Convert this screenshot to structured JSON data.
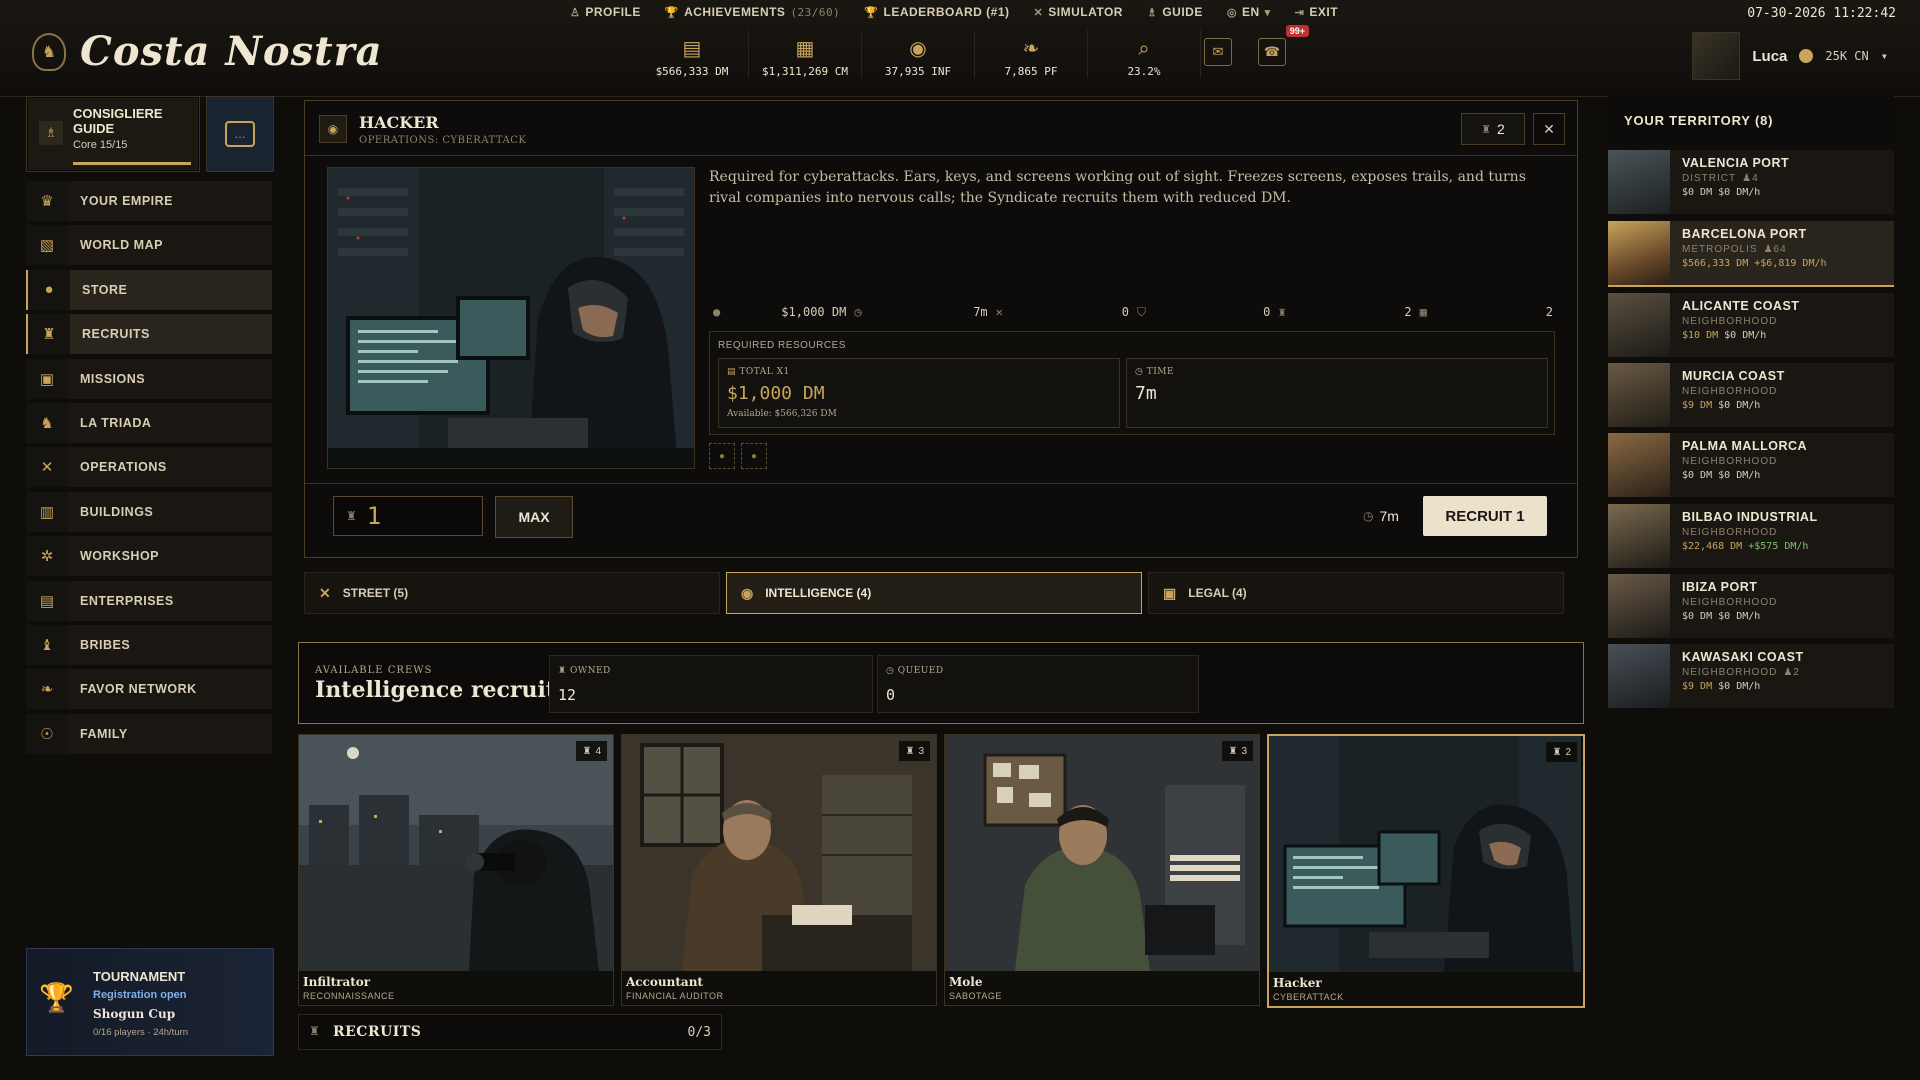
{
  "app": {
    "title": "Costa Nostra",
    "datetime": "07-30-2026 11:22:42"
  },
  "topnav": [
    {
      "label": "PROFILE",
      "sub": "",
      "icon": "user-icon"
    },
    {
      "label": "ACHIEVEMENTS",
      "sub": "(23/60)",
      "icon": "trophy-icon"
    },
    {
      "label": "LEADERBOARD (#1)",
      "sub": "",
      "icon": "trophy-icon"
    },
    {
      "label": "SIMULATOR",
      "sub": "",
      "icon": "crossed-swords-icon"
    },
    {
      "label": "GUIDE",
      "sub": "",
      "icon": "person-icon"
    },
    {
      "label": "EN",
      "sub": "",
      "icon": "globe-icon"
    },
    {
      "label": "EXIT",
      "sub": "",
      "icon": "exit-icon"
    }
  ],
  "resources": [
    {
      "value": "$566,333 DM",
      "icon": "cash-stack-icon"
    },
    {
      "value": "$1,311,269 CM",
      "icon": "clean-money-icon"
    },
    {
      "value": "37,935 INF",
      "icon": "influence-icon"
    },
    {
      "value": "7,865 PF",
      "icon": "favor-icon"
    },
    {
      "value": "23.2%",
      "icon": "heat-magnifier-icon"
    }
  ],
  "notifications": {
    "badge": "99+"
  },
  "user": {
    "name": "Luca",
    "currency": "25K CN"
  },
  "guide": {
    "title": "CONSIGLIERE GUIDE",
    "progress": "Core 15/15"
  },
  "sidebar": [
    {
      "label": "YOUR EMPIRE",
      "icon": "crown-icon"
    },
    {
      "label": "WORLD MAP",
      "icon": "map-icon"
    },
    {
      "label": "STORE",
      "icon": "coin-icon"
    },
    {
      "label": "RECRUITS",
      "icon": "recruits-icon"
    },
    {
      "label": "MISSIONS",
      "icon": "missions-icon"
    },
    {
      "label": "LA TRIADA",
      "icon": "dragon-icon"
    },
    {
      "label": "OPERATIONS",
      "icon": "crossed-swords-icon"
    },
    {
      "label": "BUILDINGS",
      "icon": "building-icon"
    },
    {
      "label": "WORKSHOP",
      "icon": "tools-icon"
    },
    {
      "label": "ENTERPRISES",
      "icon": "factory-icon"
    },
    {
      "label": "BRIBES",
      "icon": "bribe-icon"
    },
    {
      "label": "FAVOR NETWORK",
      "icon": "handshake-icon"
    },
    {
      "label": "FAMILY",
      "icon": "family-icon"
    }
  ],
  "tournament": {
    "title": "TOURNAMENT",
    "status": "Registration open",
    "name": "Shogun Cup",
    "meta": "0/16 players · 24h/turn"
  },
  "detail": {
    "title": "HACKER",
    "subtitle": "OPERATIONS: CYBERATTACK",
    "count": "2",
    "description": "Required for cyberattacks. Ears, keys, and screens working out of sight. Freezes screens, exposes trails, and turns rival companies into nervous calls; the Syndicate recruits them with reduced DM.",
    "stats": [
      {
        "icon": "cash-icon",
        "value": "$1,000 DM"
      },
      {
        "icon": "clock-icon",
        "value": "7m"
      },
      {
        "icon": "crossed-swords-icon",
        "value": "0"
      },
      {
        "icon": "shield-icon",
        "value": "0"
      },
      {
        "icon": "recruits-icon",
        "value": "2"
      },
      {
        "icon": "intel-icon",
        "value": "2"
      }
    ],
    "required_label": "REQUIRED RESOURCES",
    "total_label": "TOTAL X1",
    "total_value": "$1,000 DM",
    "available": "Available: $566,326 DM",
    "time_label": "TIME",
    "time_value": "7m",
    "quantity": "1",
    "max_label": "MAX",
    "footer_time": "7m",
    "recruit_label": "RECRUIT 1"
  },
  "tabs": [
    {
      "label": "STREET (5)",
      "icon": "crossed-swords-icon"
    },
    {
      "label": "INTELLIGENCE (4)",
      "icon": "eye-icon"
    },
    {
      "label": "LEGAL (4)",
      "icon": "briefcase-icon"
    }
  ],
  "crews": {
    "kicker": "AVAILABLE CREWS",
    "title": "Intelligence recruits",
    "owned_label": "OWNED",
    "owned": "12",
    "queued_label": "QUEUED",
    "queued": "0"
  },
  "cards": [
    {
      "name": "Infiltrator",
      "role": "RECONNAISSANCE",
      "count": "4"
    },
    {
      "name": "Accountant",
      "role": "FINANCIAL AUDITOR",
      "count": "3"
    },
    {
      "name": "Mole",
      "role": "SABOTAGE",
      "count": "3"
    },
    {
      "name": "Hacker",
      "role": "CYBERATTACK",
      "count": "2"
    }
  ],
  "recruits_bar": {
    "label": "RECRUITS",
    "value": "0/3"
  },
  "territory": {
    "title": "YOUR TERRITORY (8)",
    "items": [
      {
        "name": "VALENCIA PORT",
        "type": "DISTRICT",
        "inf": "4",
        "dm": "$0 DM",
        "rate": "$0 DM/h"
      },
      {
        "name": "BARCELONA PORT",
        "type": "METROPOLIS",
        "inf": "64",
        "dm": "$566,333 DM",
        "rate": "+$6,819 DM/h"
      },
      {
        "name": "ALICANTE COAST",
        "type": "NEIGHBORHOOD",
        "inf": "",
        "dm": "$10 DM",
        "rate": "$0 DM/h"
      },
      {
        "name": "MURCIA COAST",
        "type": "NEIGHBORHOOD",
        "inf": "",
        "dm": "$9 DM",
        "rate": "$0 DM/h"
      },
      {
        "name": "PALMA MALLORCA",
        "type": "NEIGHBORHOOD",
        "inf": "",
        "dm": "$0 DM",
        "rate": "$0 DM/h"
      },
      {
        "name": "BILBAO INDUSTRIAL",
        "type": "NEIGHBORHOOD",
        "inf": "",
        "dm": "$22,468 DM",
        "rate": "+$575 DM/h"
      },
      {
        "name": "IBIZA PORT",
        "type": "NEIGHBORHOOD",
        "inf": "",
        "dm": "$0 DM",
        "rate": "$0 DM/h"
      },
      {
        "name": "KAWASAKI COAST",
        "type": "NEIGHBORHOOD",
        "inf": "2",
        "dm": "$9 DM",
        "rate": "$0 DM/h"
      }
    ]
  },
  "colors": {
    "accent": "#c9a45c",
    "positive": "#7fc06a",
    "badge": "#c03030"
  }
}
